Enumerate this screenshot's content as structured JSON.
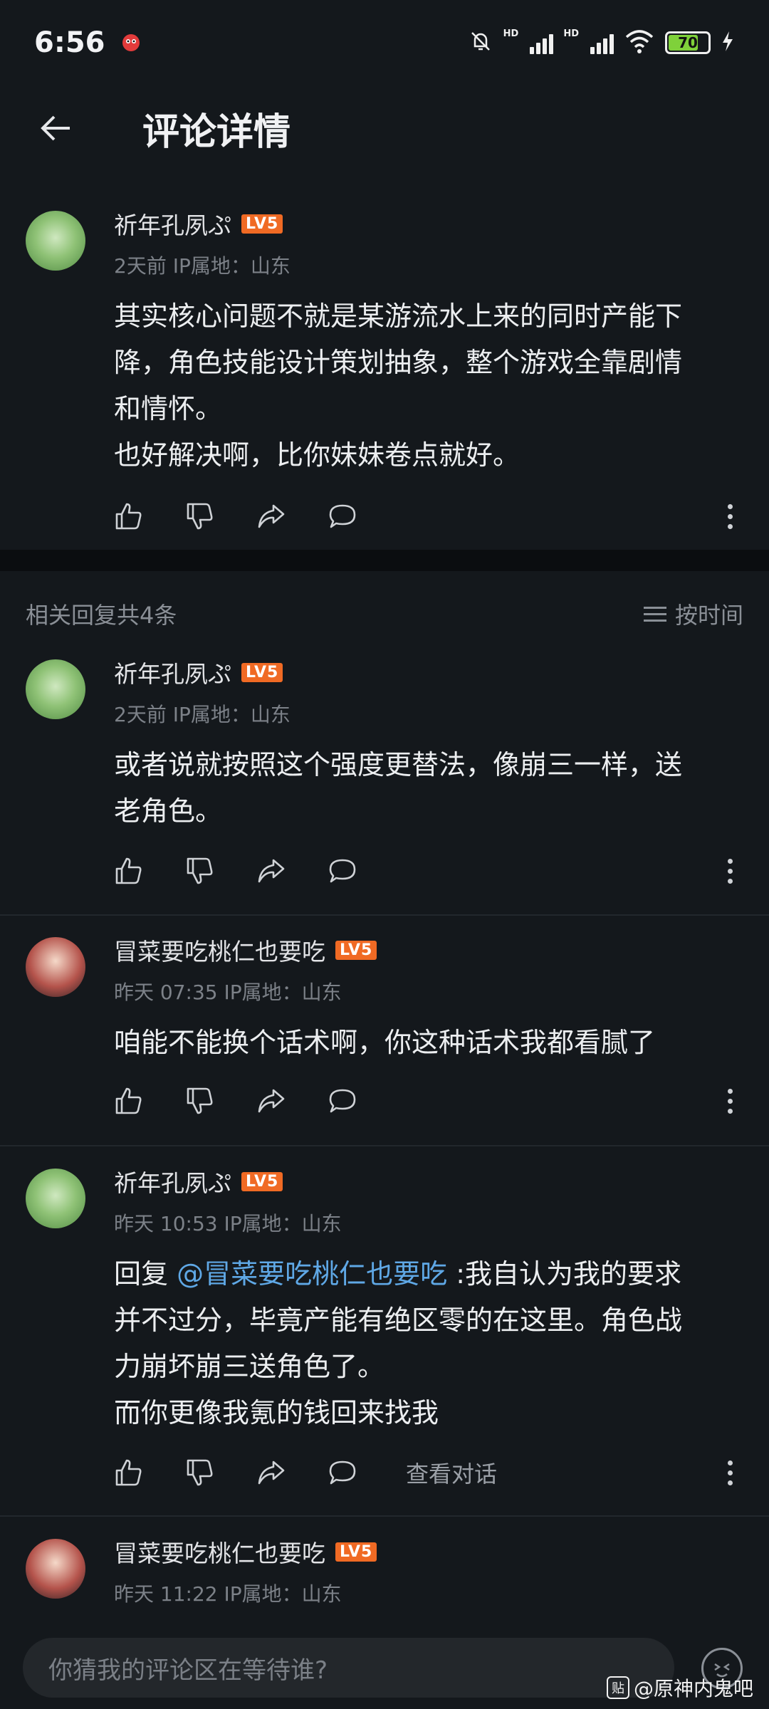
{
  "status_bar": {
    "time": "6:56",
    "battery": "70"
  },
  "app_bar": {
    "title": "评论详情"
  },
  "main_comment": {
    "username": "祈年孔夙ぷ",
    "level": "LV5",
    "meta": "2天前 IP属地：山东",
    "text_lines": [
      "其实核心问题不就是某游流水上来的同时产能下",
      "降，角色技能设计策划抽象，整个游戏全靠剧情",
      "和情怀。",
      "也好解决啊，比你妹妹卷点就好。"
    ]
  },
  "replies_header": {
    "count_label": "相关回复共4条",
    "sort_label": "按时间"
  },
  "replies": [
    {
      "username": "祈年孔夙ぷ",
      "level": "LV5",
      "meta": "2天前 IP属地：山东",
      "text_lines": [
        "或者说就按照这个强度更替法，像崩三一样，送",
        "老角色。"
      ]
    },
    {
      "username": "冒菜要吃桃仁也要吃",
      "level": "LV5",
      "meta": "昨天 07:35 IP属地：山东",
      "text_lines": [
        "咱能不能换个话术啊，你这种话术我都看腻了"
      ]
    },
    {
      "username": "祈年孔夙ぷ",
      "level": "LV5",
      "meta": "昨天 10:53 IP属地：山东",
      "reply_prefix": "回复 ",
      "mention": "@冒菜要吃桃仁也要吃",
      "first_line_rest": " :我自认为我的要求",
      "text_lines": [
        "并不过分，毕竟产能有绝区零的在这里。角色战",
        "力崩坏崩三送角色了。",
        "而你更像我氪的钱回来找我"
      ],
      "view_conversation": "查看对话"
    },
    {
      "username": "冒菜要吃桃仁也要吃",
      "level": "LV5",
      "meta": "昨天 11:22 IP属地：山东"
    }
  ],
  "input": {
    "placeholder": "你猜我的评论区在等待谁?"
  },
  "watermark": {
    "icon_text": "贴",
    "text": "@原神内鬼吧"
  },
  "colors": {
    "background": "#14181c",
    "accent_level": "#f06a24",
    "mention": "#5fa8e6"
  }
}
